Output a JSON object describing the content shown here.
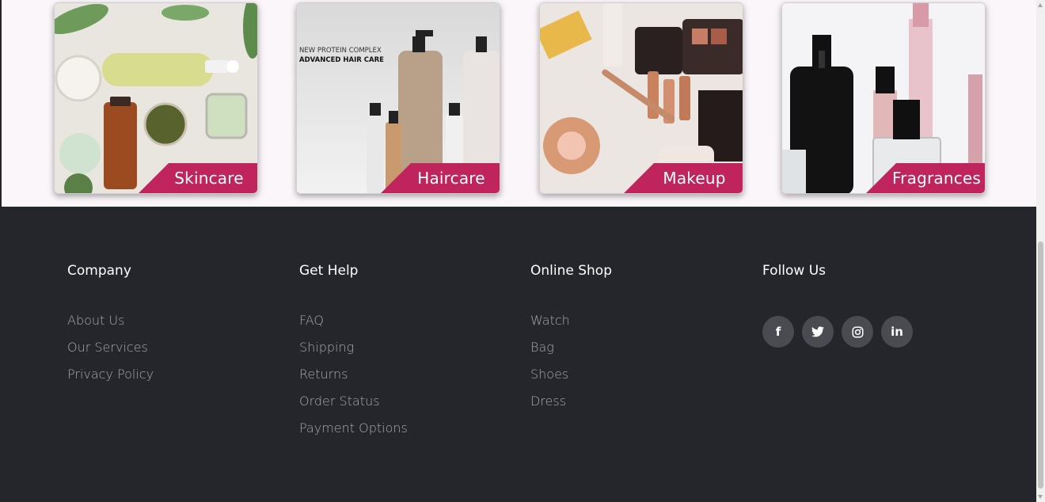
{
  "categories": [
    {
      "label": "Skincare",
      "image": "skincare-products-image"
    },
    {
      "label": "Haircare",
      "image": "haircare-products-image",
      "image_text": [
        "NEW PROTEIN COMPLEX",
        "ADVANCED HAIR CARE"
      ]
    },
    {
      "label": "Makeup",
      "image": "makeup-products-image"
    },
    {
      "label": "Fragrances",
      "image": "fragrance-bottles-image"
    }
  ],
  "footer": {
    "company": {
      "title": "Company",
      "links": [
        "About Us",
        "Our Services",
        "Privacy Policy"
      ]
    },
    "help": {
      "title": "Get Help",
      "links": [
        "FAQ",
        "Shipping",
        "Returns",
        "Order Status",
        "Payment Options"
      ]
    },
    "shop": {
      "title": "Online Shop",
      "links": [
        "Watch",
        "Bag",
        "Shoes",
        "Dress"
      ]
    },
    "follow": {
      "title": "Follow Us",
      "socials": [
        {
          "icon": "facebook-icon",
          "glyph": "f"
        },
        {
          "icon": "twitter-icon",
          "glyph": ""
        },
        {
          "icon": "instagram-icon",
          "glyph": ""
        },
        {
          "icon": "linkedin-icon",
          "glyph": "in"
        }
      ]
    }
  },
  "colors": {
    "accent": "#c0245c",
    "footer_bg": "#24262b",
    "link": "#a9a9ad",
    "social_bg": "#4a4b50"
  }
}
